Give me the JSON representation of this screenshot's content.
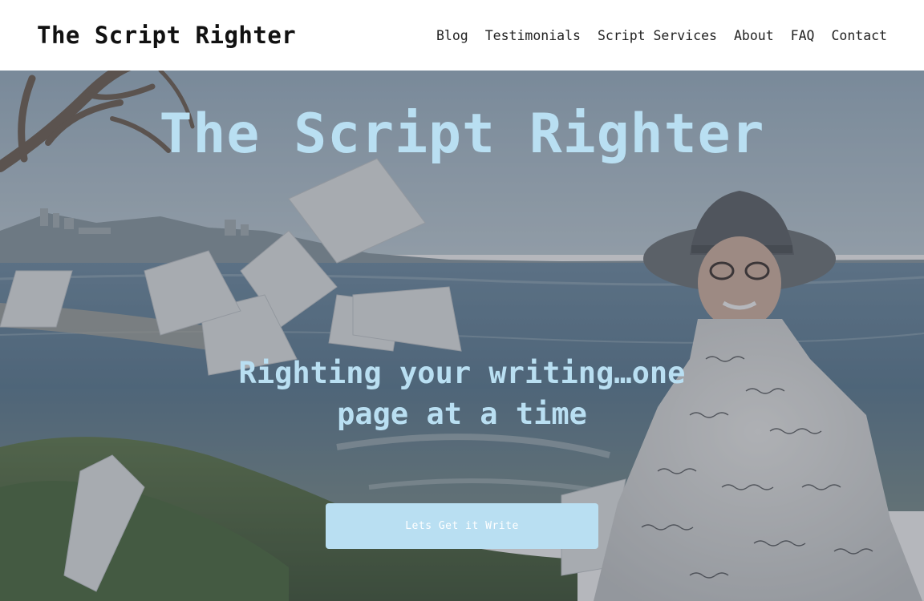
{
  "header": {
    "brand": "The Script Righter",
    "nav": [
      {
        "label": "Blog"
      },
      {
        "label": "Testimonials"
      },
      {
        "label": "Script Services"
      },
      {
        "label": "About"
      },
      {
        "label": "FAQ"
      },
      {
        "label": "Contact"
      }
    ]
  },
  "hero": {
    "title": "The Script Righter",
    "subtitle": "Righting your writing…one page at a time",
    "cta_label": "Lets Get it Write",
    "accent_color": "#b9dff2",
    "background_image": "woman in a wide-brim hat and script-print blouse on an ocean bluff with flying pages"
  }
}
